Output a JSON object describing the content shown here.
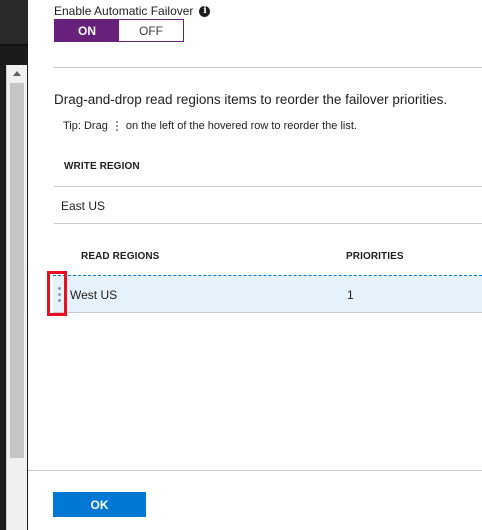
{
  "failover": {
    "label": "Enable Automatic Failover",
    "info_icon_glyph": "i",
    "toggle": {
      "on_label": "ON",
      "off_label": "OFF",
      "selected": "ON"
    }
  },
  "instructions": {
    "text": "Drag-and-drop read regions items to reorder the failover priorities.",
    "tip_before": "Tip: Drag",
    "tip_after": "on the left of the hovered row to reorder the list."
  },
  "write_region": {
    "header": "WRITE REGION",
    "value": "East US"
  },
  "read_regions": {
    "headers": {
      "region": "READ REGIONS",
      "priority": "PRIORITIES"
    },
    "rows": [
      {
        "region": "West US",
        "priority": "1"
      }
    ]
  },
  "footer": {
    "ok_label": "OK"
  },
  "colors": {
    "toggle_on": "#68217a",
    "primary_button": "#0078d4",
    "row_hover": "#e6f2fb",
    "highlight_box": "#e81123"
  },
  "icons": [
    "info-icon",
    "drag-handle-icon",
    "scroll-up-arrow-icon"
  ]
}
